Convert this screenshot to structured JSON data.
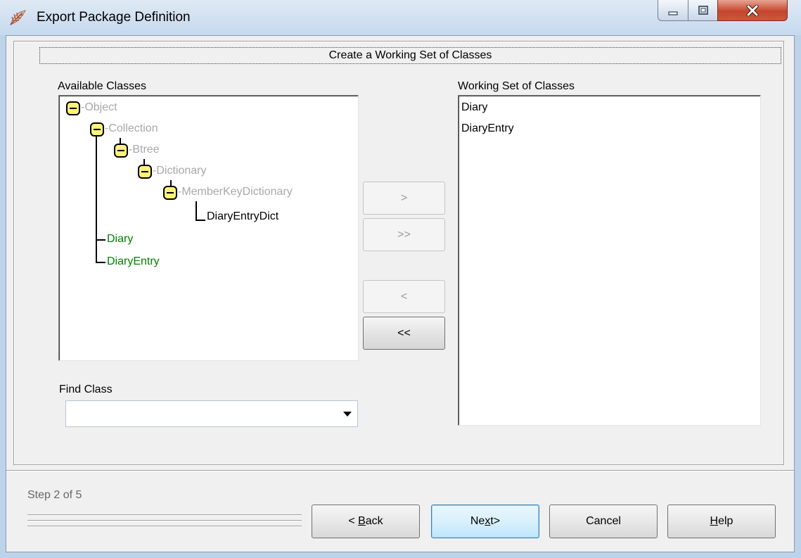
{
  "window": {
    "title": "Export Package Definition",
    "icon": "app-leaf-icon"
  },
  "panel": {
    "header": "Create a Working Set of Classes"
  },
  "available": {
    "label": "Available Classes",
    "tree": [
      {
        "label": "Object",
        "state": "inherited-gray",
        "expanded": true
      },
      {
        "label": "Collection",
        "state": "inherited-gray",
        "expanded": true
      },
      {
        "label": "Btree",
        "state": "inherited-gray",
        "expanded": true
      },
      {
        "label": "Dictionary",
        "state": "inherited-gray",
        "expanded": true
      },
      {
        "label": "MemberKeyDictionary",
        "state": "inherited-gray",
        "expanded": true
      },
      {
        "label": "DiaryEntryDict",
        "state": "normal"
      },
      {
        "label": "Diary",
        "state": "selected-green"
      },
      {
        "label": "DiaryEntry",
        "state": "selected-green"
      }
    ]
  },
  "working": {
    "label": "Working Set of Classes",
    "items": [
      "Diary",
      "DiaryEntry"
    ]
  },
  "move_buttons": {
    "add": ">",
    "add_all": ">>",
    "remove": "<",
    "remove_all": "<<"
  },
  "find": {
    "label": "Find Class",
    "value": ""
  },
  "footer": {
    "step": "Step 2 of 5",
    "back": {
      "prefix": "< ",
      "mnemonic": "B",
      "rest": "ack"
    },
    "next": {
      "prefix": "Ne",
      "mnemonic": "x",
      "rest": "t>"
    },
    "cancel": "Cancel",
    "help": {
      "mnemonic": "H",
      "rest": "elp"
    }
  },
  "colors": {
    "inherited": "#a8a8a8",
    "selected": "#008000",
    "node_fill": "#fff37a"
  }
}
